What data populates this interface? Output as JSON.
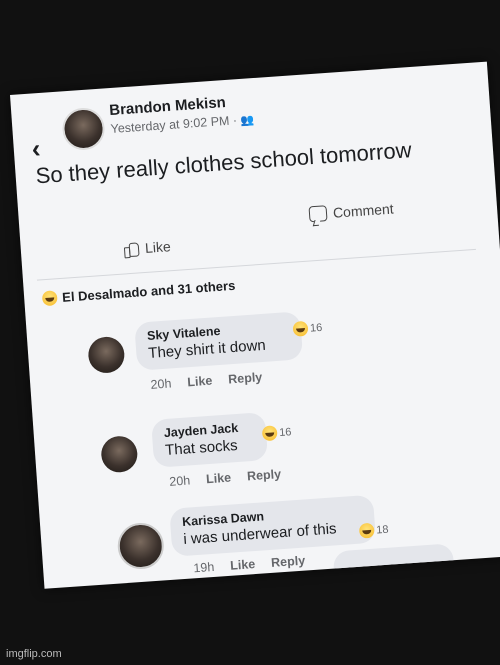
{
  "post": {
    "author": "Brandon Mekisn",
    "timestamp": "Yesterday at 9:02 PM ·",
    "text": "So they really clothes school tomorrow",
    "like_label": "Like",
    "comment_label": "Comment"
  },
  "reactions": {
    "summary": "El Desalmado and 31 others"
  },
  "comments": [
    {
      "name": "Sky Vitalene",
      "text": "They shirt it down",
      "time": "20h",
      "like": "Like",
      "reply": "Reply",
      "count": "16"
    },
    {
      "name": "Jayden Jack",
      "text": "That socks",
      "time": "20h",
      "like": "Like",
      "reply": "Reply",
      "count": "16"
    },
    {
      "name": "Karissa Dawn",
      "text": "i was underwear of this",
      "time": "19h",
      "like": "Like",
      "reply": "Reply",
      "count": "18"
    }
  ],
  "watermark": "imgflip.com",
  "icons": {
    "back": "chevron-left-icon",
    "like": "thumbs-up-icon",
    "comment": "comment-icon",
    "haha": "haha-emoji-icon"
  }
}
